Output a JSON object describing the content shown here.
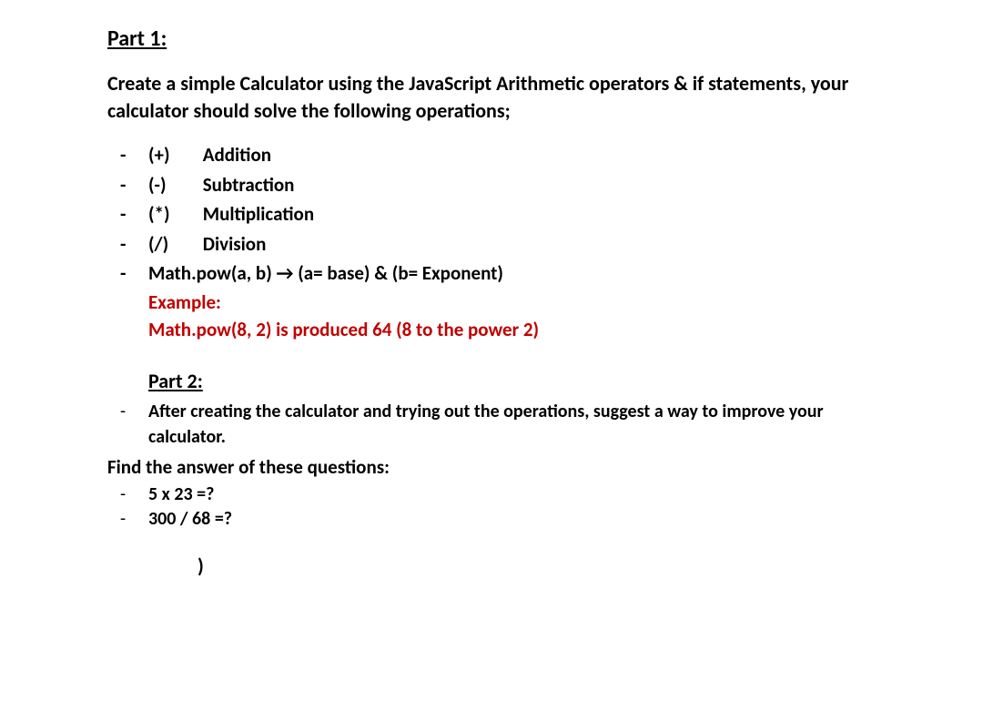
{
  "part1": {
    "heading": "Part 1:",
    "intro": "Create a simple Calculator using the JavaScript Arithmetic operators & if statements, your calculator should solve the following operations;",
    "operations": [
      {
        "symbol": "(+)",
        "name": "Addition"
      },
      {
        "symbol": "(-)",
        "name": "Subtraction"
      },
      {
        "symbol": "(*)",
        "name": "Multiplication"
      },
      {
        "symbol": "(/)",
        "name": "Division"
      }
    ],
    "mathpow": " Math.pow(a, b) → (a= base) & (b= Exponent)",
    "example_label": "Example:",
    "example_text": "Math.pow(8, 2) is produced 64 (8 to the power 2)"
  },
  "part2": {
    "heading": "Part 2:",
    "suggestion": "After creating the calculator and trying out the operations, suggest a way to improve your calculator.",
    "find_answer": "Find the answer of these questions:",
    "questions": [
      "5 x 23 =?",
      "300 / 68 =?"
    ]
  },
  "trailing": ")"
}
